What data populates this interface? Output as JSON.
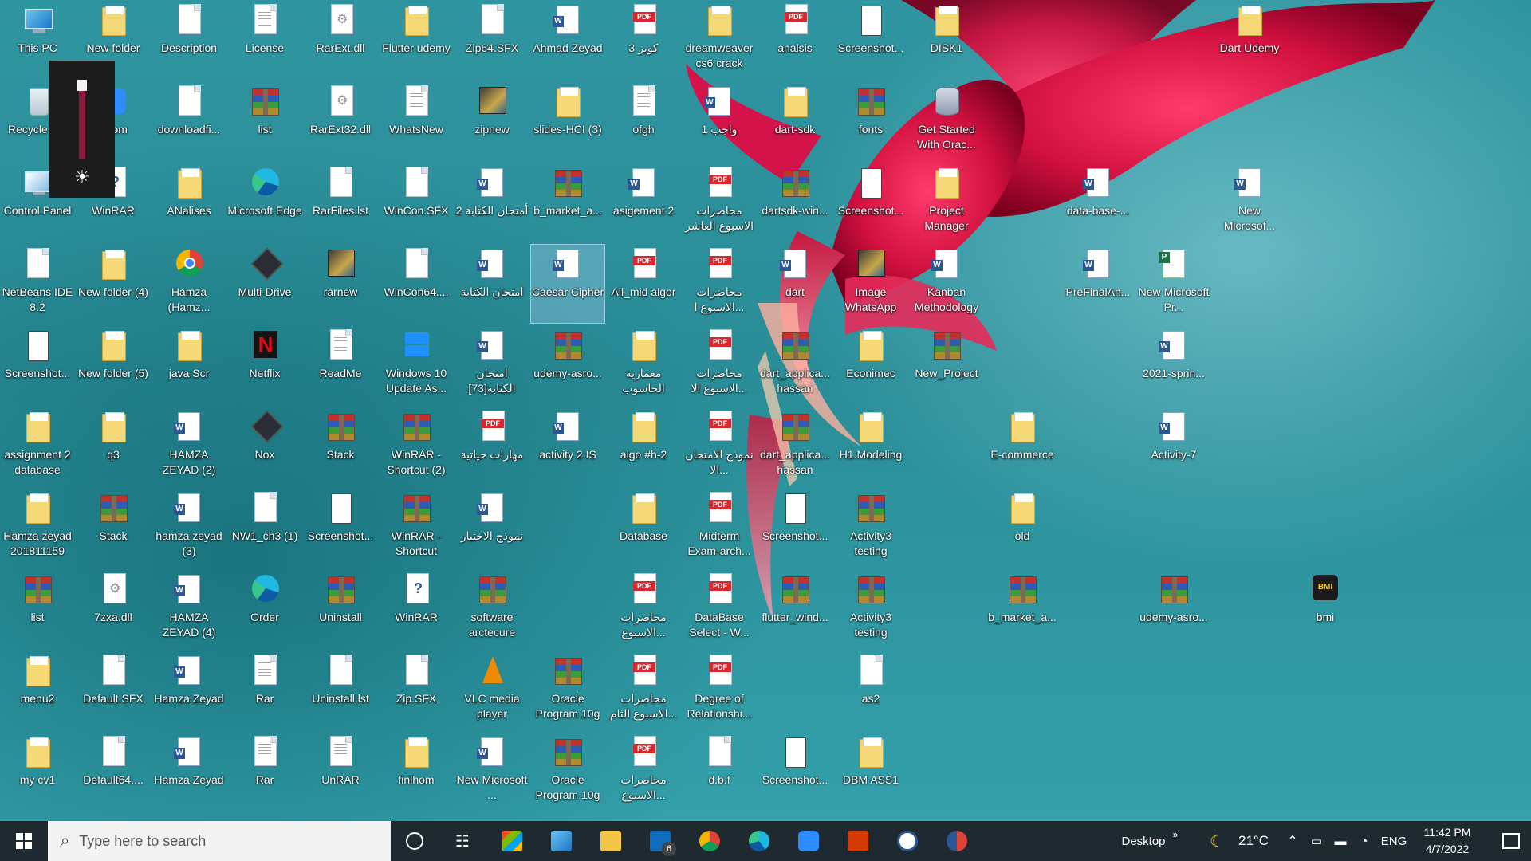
{
  "desktop": {
    "columns": [
      [
        "This PC",
        "Recycle Bin",
        "Control Panel",
        "NetBeans IDE 8.2",
        "Screenshot...",
        "assignment 2 database",
        "Hamza zeyad 201811159",
        "list",
        "menu2",
        "my cv1"
      ],
      [
        "New folder",
        "Zoom",
        "WinRAR",
        "New folder (4)",
        "New folder (5)",
        "q3",
        "Stack",
        "7zxa.dll",
        "Default.SFX",
        "Default64...."
      ],
      [
        "Description",
        "downloadfi...",
        "ANalises",
        "Hamza (Hamz...",
        "java Scr",
        "HAMZA ZEYAD (2)",
        "hamza zeyad (3)",
        "HAMZA ZEYAD (4)",
        "Hamza Zeyad",
        "Hamza Zeyad"
      ],
      [
        "License",
        "list",
        "Microsoft Edge",
        "Multi-Drive",
        "Netflix",
        "Nox",
        "NW1_ch3 (1)",
        "Order",
        "Rar",
        "Rar"
      ],
      [
        "RarExt.dll",
        "RarExt32.dll",
        "RarFiles.lst",
        "rarnew",
        "ReadMe",
        "Stack",
        "Screenshot...",
        "Uninstall",
        "Uninstall.lst",
        "UnRAR"
      ],
      [
        "Flutter udemy",
        "WhatsNew",
        "WinCon.SFX",
        "WinCon64....",
        "Windows 10 Update As...",
        "WinRAR - Shortcut (2)",
        "WinRAR - Shortcut",
        "WinRAR",
        "Zip.SFX",
        "finlhom"
      ],
      [
        "Zip64.SFX",
        "zipnew",
        "أمتحان الكتابة 2",
        "امتحان الكتابة",
        "امتحان الكتابة[73]",
        "مهارات حياتية",
        "نموذج الاختبار",
        "software arctecure",
        "VLC media player",
        "New Microsoft ..."
      ],
      [
        "Ahmad Zeyad",
        "slides-HCI (3)",
        "b_market_a...",
        "Caesar Cipher",
        "udemy-asro...",
        "activity 2 IS",
        "",
        "",
        "Oracle Program 10g",
        "Oracle Program 10g"
      ],
      [
        "كويز 3",
        "ofgh",
        "asigement 2",
        "All_mid algor",
        "معمارية الحاسوب",
        "algo #h-2",
        "Database",
        "محاضرات الاسبوع...",
        "محاضرات الاسبوع الثام...",
        "محاضرات الاسبوع..."
      ],
      [
        "dreamweaver cs6 crack",
        "واجب 1",
        "محاضرات الاسبوع العاشر",
        "محاضرات الاسبوع ا...",
        "محاضرات الاسبوع الا...",
        "نموذج الامتحان الا...",
        "Midterm Exam-arch...",
        "DataBase Select - W...",
        "Degree of Relationshi...",
        "d.b.f"
      ],
      [
        "analsis",
        "dart-sdk",
        "dartsdk-win...",
        "dart",
        "dart_applica... hassan",
        "dart_applica... hassan",
        "Screenshot...",
        "flutter_wind...",
        "",
        "Screenshot..."
      ],
      [
        "Screenshot...",
        "fonts",
        "Screenshot...",
        "Image WhatsApp",
        "Econimec",
        "H1.Modeling",
        "Activity3 testing",
        "Activity3 testing",
        "as2",
        "DBM ASS1"
      ],
      [
        "DISK1",
        "Get Started With Orac...",
        "Project Manager",
        "Kanban Methodology",
        "New_Project",
        "",
        "",
        "",
        "",
        ""
      ],
      [
        "",
        "",
        "",
        "",
        "",
        "E-commerce",
        "old",
        "b_market_a...",
        "",
        ""
      ],
      [
        "",
        "",
        "data-base-...",
        "PreFinalAn...",
        "",
        "",
        "",
        "",
        "",
        ""
      ],
      [
        "",
        "",
        "",
        "New Microsoft Pr...",
        "2021-sprin...",
        "Activity-7",
        "",
        "udemy-asro...",
        "",
        ""
      ],
      [
        "Dart Udemy",
        "",
        "New Microsof...",
        "",
        "",
        "",
        "",
        "",
        "",
        ""
      ],
      [
        "",
        "",
        "",
        "",
        "",
        "",
        "",
        "bmi",
        "",
        ""
      ]
    ],
    "selected": "Caesar Cipher"
  },
  "taskbar": {
    "search_placeholder": "Type here to search",
    "toolbar_label": "Desktop",
    "weather": "21°C",
    "language": "ENG",
    "time": "11:42 PM",
    "date": "4/7/2022",
    "mail_badge": "6"
  },
  "colors": {
    "accent_slider": "#8b1b3c",
    "taskbar_bg": "#1f2a30",
    "desktop_bg": "#2a8e98"
  }
}
